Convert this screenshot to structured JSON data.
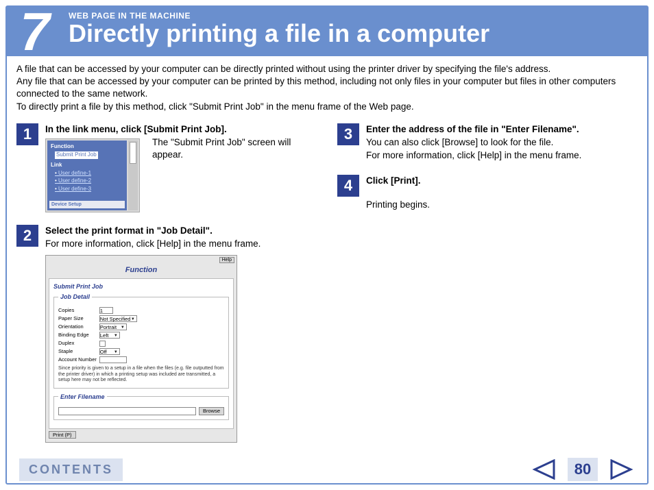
{
  "header": {
    "chapter": "7",
    "kicker": "WEB PAGE IN THE MACHINE",
    "title": "Directly printing a file in a computer"
  },
  "intro": {
    "p1": "A file that can be accessed by your computer can be directly printed without using the printer driver by specifying the file's address.",
    "p2": "Any file that can be accessed by your computer can be printed by this method, including not only files in your computer but files in other computers connected to the same network.",
    "p3": "To directly print a file by this method, click \"Submit Print Job\" in the menu frame of the Web page."
  },
  "steps": {
    "s1": {
      "num": "1",
      "head": "In the link menu, click [Submit Print Job].",
      "text": "The \"Submit Print Job\" screen will appear."
    },
    "s2": {
      "num": "2",
      "head": "Select the print format in \"Job Detail\".",
      "text": "For more information, click [Help] in the menu frame."
    },
    "s3": {
      "num": "3",
      "head": "Enter the address of the file in \"Enter Filename\".",
      "text1": "You can also click [Browse] to look for the file.",
      "text2": "For more information, click [Help] in the menu frame."
    },
    "s4": {
      "num": "4",
      "head": "Click [Print].",
      "text": "Printing begins."
    }
  },
  "shot1": {
    "function_label": "Function",
    "selected": "Submit Print Job",
    "link_label": "Link",
    "links": {
      "l1": "User define-1",
      "l2": "User define-2",
      "l3": "User define-3"
    },
    "device_setup": "Device Setup"
  },
  "shot2": {
    "help": "Help",
    "function": "Function",
    "title": "Submit Print Job",
    "job_detail": "Job Detail",
    "rows": {
      "copies": "Copies",
      "copies_v": "1",
      "paper": "Paper Size",
      "paper_v": "Not Specified",
      "orient": "Orientation",
      "orient_v": "Portrait",
      "binding": "Binding Edge",
      "binding_v": "Left",
      "duplex": "Duplex",
      "staple": "Staple",
      "staple_v": "Off",
      "account": "Account Number"
    },
    "note": "Since priority is given to a setup in a file when the files (e.g. file outputted from the printer driver) in which a printing setup was included are transmitted, a setup here may not be reflected.",
    "enter_filename": "Enter Filename",
    "browse": "Browse",
    "print": "Print (P)"
  },
  "footer": {
    "contents": "CONTENTS",
    "page": "80"
  }
}
